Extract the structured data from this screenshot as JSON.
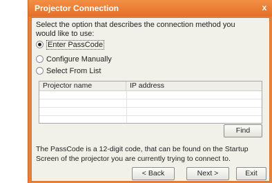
{
  "window": {
    "title": "Projector Connection",
    "close_glyph": "x"
  },
  "instruction": "Select the option that describes the connection method you would like to use:",
  "options": [
    {
      "label": "Enter PassCode",
      "selected": true
    },
    {
      "label": "Configure Manually",
      "selected": false
    },
    {
      "label": "Select From List",
      "selected": false
    }
  ],
  "table": {
    "columns": [
      "Projector name",
      "IP address"
    ],
    "rows": []
  },
  "buttons": {
    "find": "Find",
    "back": "< Back",
    "next": "Next >",
    "exit": "Exit"
  },
  "help_text": "The PassCode is a 12-digit code, that can be found on the Startup Screen of the projector you are currently trying to connect to.",
  "colors": {
    "frame": "#e7803a",
    "client": "#f1f1ea"
  }
}
